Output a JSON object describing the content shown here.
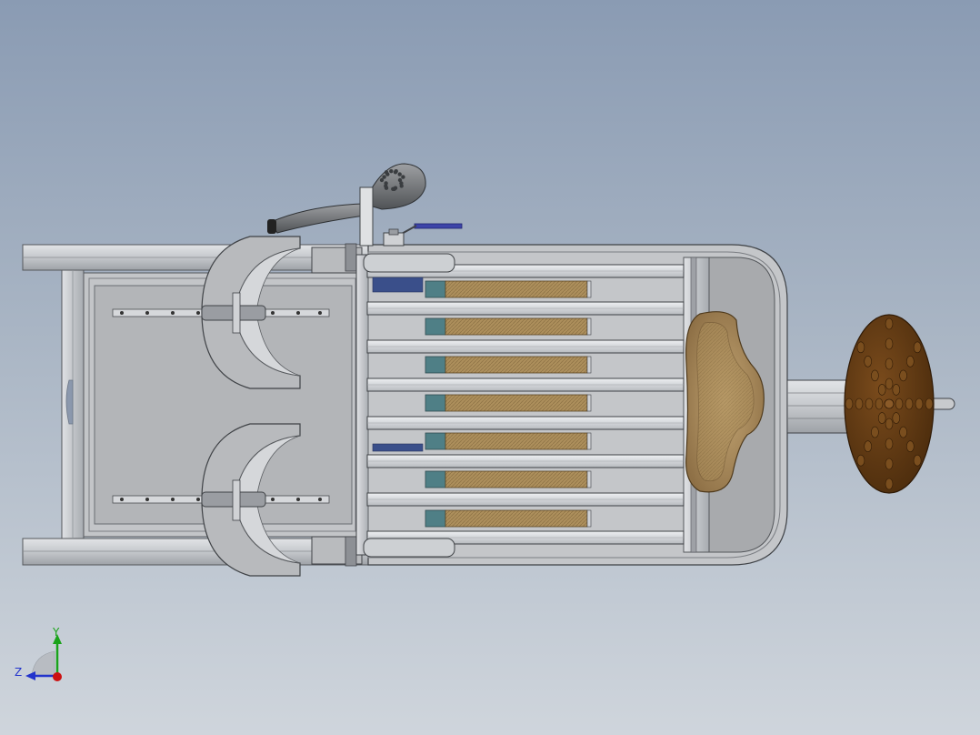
{
  "viewport": {
    "background_top": "#8a9bb3",
    "background_bottom": "#cfd5dc"
  },
  "model": {
    "frame_color": "#c9ccd0",
    "panel_color": "#b5b7ba",
    "dark_grey": "#6f7276",
    "filter_color": "#a88a57",
    "filter_end_color": "#4f7f86",
    "seat_color": "#a98b5c",
    "wheel_color": "#5a3612",
    "wheel_dot_color": "#7a4e1e",
    "handle_color": "#3d44a8"
  },
  "triad": {
    "y_label": "Y",
    "z_label": "Z",
    "y_color": "#1aa31a",
    "z_color": "#2233cc",
    "x_color": "#cc1111"
  }
}
